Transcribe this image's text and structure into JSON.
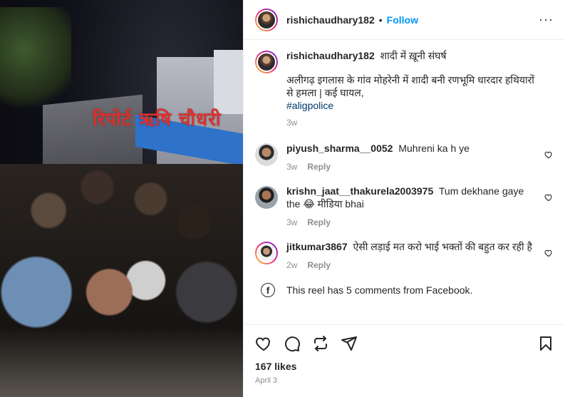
{
  "media": {
    "watermark": "रिपोर्ट ऋषि चौधरी"
  },
  "header": {
    "username": "rishichaudhary182",
    "separator": "•",
    "follow_label": "Follow",
    "more_label": "···"
  },
  "caption": {
    "username": "rishichaudhary182",
    "title": "शादी में ख़ूनी संघर्ष",
    "line1": "अलीगढ़ इगलास के गांव मोहरेनी में शादी बनी रणभूमि धारदार हथियारों से हमला | कई घायल,",
    "hashtag": "#aligpolice",
    "time": "3w"
  },
  "comments": [
    {
      "username": "piyush_sharma__0052",
      "text": "Muhreni ka h ye",
      "time": "3w",
      "reply": "Reply"
    },
    {
      "username": "krishn_jaat__thakurela2003975",
      "text": "Tum dekhane gaye the 😂 मीडिया bhai",
      "time": "3w",
      "reply": "Reply"
    },
    {
      "username": "jitkumar3867",
      "text": "ऐसी लड़ाई मत करो भाई भक्तों की बहुत कर रही है",
      "time": "2w",
      "reply": "Reply"
    }
  ],
  "facebook_note": {
    "icon": "f",
    "text": "This reel has 5 comments from Facebook."
  },
  "footer": {
    "likes": "167 likes",
    "date": "April 3"
  },
  "colors": {
    "link": "#0095f6",
    "hashtag": "#00376b",
    "muted": "#8e8e8e",
    "watermark": "#d9322e"
  }
}
